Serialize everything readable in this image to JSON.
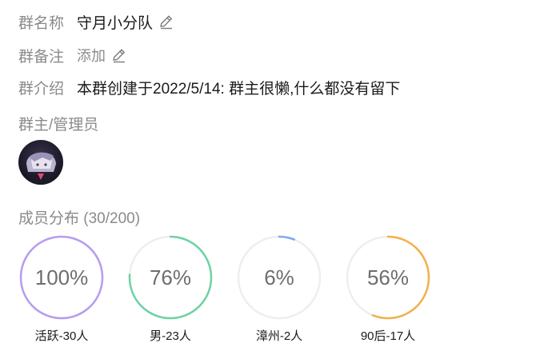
{
  "group": {
    "name_label": "群名称",
    "name_value": "守月小分队",
    "note_label": "群备注",
    "note_add": "添加",
    "intro_label": "群介绍",
    "intro_value": "本群创建于2022/5/14:  群主很懒,什么都没有留下",
    "admins_label": "群主/管理员"
  },
  "members": {
    "title": "成员分布 (30/200)",
    "stats": [
      {
        "percent_text": "100%",
        "percent": 100,
        "caption": "活跃-30人",
        "color": "#b79cf1"
      },
      {
        "percent_text": "76%",
        "percent": 76,
        "caption": "男-23人",
        "color": "#6fd2a3"
      },
      {
        "percent_text": "6%",
        "percent": 6,
        "caption": "漳州-2人",
        "color": "#7eaaf2"
      },
      {
        "percent_text": "56%",
        "percent": 56,
        "caption": "90后-17人",
        "color": "#f4b04c"
      }
    ],
    "track_color": "#eeeeee"
  },
  "icons": {
    "edit": "pencil-icon",
    "avatar": "admin-avatar"
  }
}
